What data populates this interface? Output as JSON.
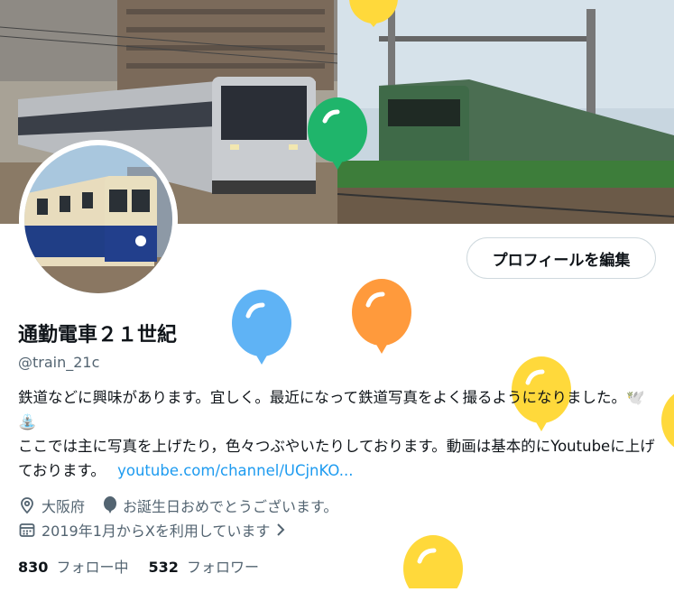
{
  "profile": {
    "display_name": "通勤電車２１世紀",
    "handle": "@train_21c",
    "edit_profile_label": "プロフィールを編集",
    "bio_line1": "鉄道などに興味があります。宜しく。最近になって鉄道写真をよく撮るようになりました。🕊️⛲",
    "bio_line2": "ここでは主に写真を上げたり，色々つぶやいたりしております。動画は基本的にYoutubeに上げております。",
    "bio_link": "youtube.com/channel/UCjnKO...",
    "location": "大阪府",
    "birthday": "お誕生日おめでとうございます。",
    "joined": "2019年1月からXを利用しています"
  },
  "stats": {
    "following_count": "830",
    "following_label": "フォロー中",
    "followers_count": "532",
    "followers_label": "フォロワー"
  },
  "colors": {
    "link": "#1d9bf0",
    "secondary_text": "#536471",
    "balloon_blue": "#5fb3f5",
    "balloon_orange": "#ff9a3c",
    "balloon_yellow": "#ffd93b",
    "balloon_green": "#1fb56b"
  }
}
